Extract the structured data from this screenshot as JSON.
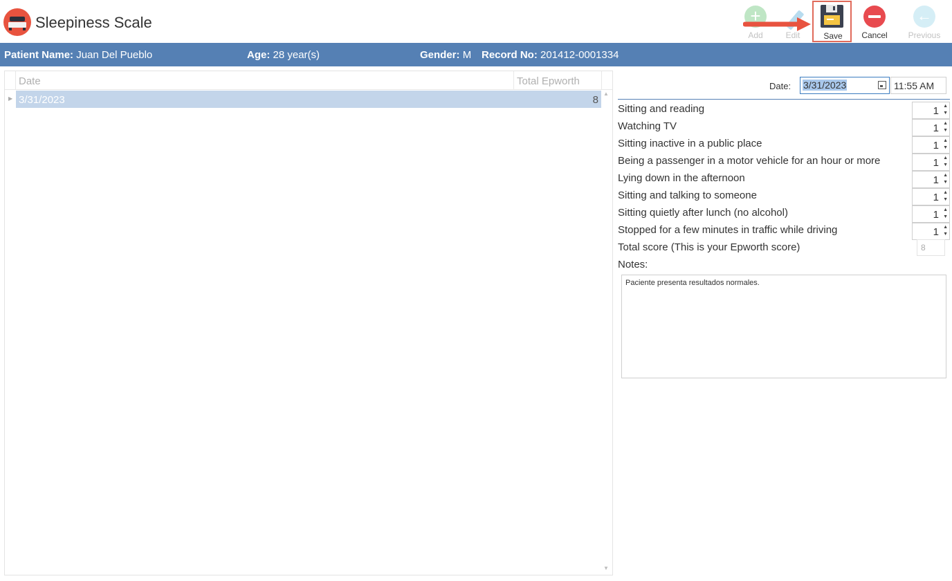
{
  "app": {
    "title": "Sleepiness Scale",
    "icon": "bed-icon"
  },
  "toolbar": {
    "add_label": "Add",
    "edit_label": "Edit",
    "save_label": "Save",
    "cancel_label": "Cancel",
    "previous_label": "Previous"
  },
  "patient": {
    "name_label": "Patient Name:",
    "name": "Juan Del Pueblo",
    "age_label": "Age:",
    "age": "28 year(s)",
    "gender_label": "Gender:",
    "gender": "M",
    "record_label": "Record No:",
    "record": "201412-0001334"
  },
  "grid": {
    "columns": [
      "Date",
      "Total Epworth"
    ],
    "rows": [
      {
        "date": "3/31/2023",
        "total": "8"
      }
    ]
  },
  "form": {
    "date_label": "Date:",
    "date": "3/31/2023",
    "time": "11:55 AM",
    "questions": [
      {
        "label": "Sitting and reading",
        "value": "1"
      },
      {
        "label": "Watching TV",
        "value": "1"
      },
      {
        "label": "Sitting inactive in a public place",
        "value": "1"
      },
      {
        "label": "Being a passenger in a motor vehicle for an hour or more",
        "value": "1"
      },
      {
        "label": "Lying down in the afternoon",
        "value": "1"
      },
      {
        "label": "Sitting and talking to someone",
        "value": "1"
      },
      {
        "label": "Sitting quietly after lunch (no alcohol)",
        "value": "1"
      },
      {
        "label": "Stopped for a few minutes in traffic while driving",
        "value": "1"
      }
    ],
    "total_label": "Total score (This is your Epworth score)",
    "total": "8",
    "notes_label": "Notes:",
    "notes": "Paciente presenta resultados normales."
  },
  "colors": {
    "accent_bar": "#5580b4",
    "selected_row": "#c3d5ea",
    "highlight": "#e06a5a"
  }
}
